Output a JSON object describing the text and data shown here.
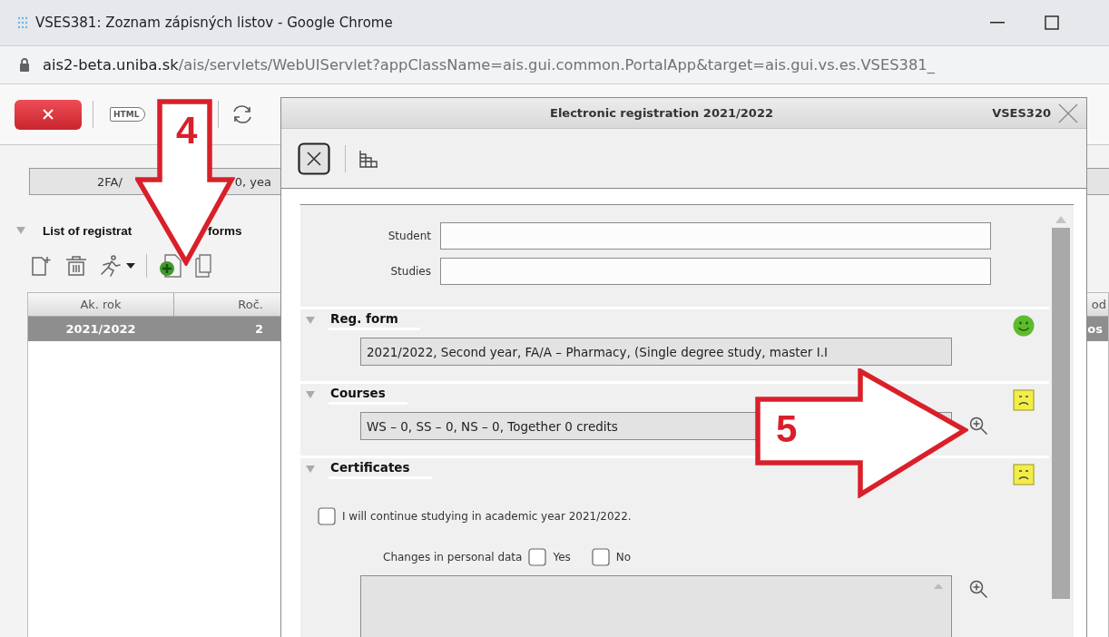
{
  "window": {
    "title": "VSES381: Zoznam zápisných listov - Google Chrome"
  },
  "address_bar": {
    "host": "ais2-beta.uniba.sk",
    "path": "/ais/servlets/WebUIServlet?appClassName=ais.gui.common.PortalApp&target=ais.gui.vs.es.VSES381_"
  },
  "page": {
    "html_button": "HTML",
    "study_field": [
      "2FA/",
      "0, yea"
    ],
    "list_section": {
      "title": [
        "List of registrat",
        "forms"
      ],
      "expanded": true
    },
    "table": {
      "columns": [
        "Ak. rok",
        "Roč.",
        "od"
      ],
      "rows": [
        {
          "cells": [
            "2021/2022",
            "2",
            "os"
          ],
          "selected": true
        }
      ]
    }
  },
  "dialog": {
    "title": "Electronic registration 2021/2022",
    "code": "VSES320",
    "fields": [
      {
        "label": "Student"
      },
      {
        "label": "Studies"
      }
    ],
    "sections": [
      {
        "kind": "field",
        "title": "Reg. form",
        "expanded": true,
        "complete": true,
        "value": "2021/2022, Second year, FA/A – Pharmacy, (Single degree study, master I.I",
        "zoom": false
      },
      {
        "kind": "field",
        "title": "Courses",
        "expanded": true,
        "complete": false,
        "value": "WS – 0, SS – 0, NS – 0, Together 0 credits",
        "zoom": true
      },
      {
        "kind": "certificates",
        "title": "Certificates",
        "expanded": true,
        "complete": false,
        "continue": {
          "label": "I will continue studying in academic year 2021/2022.",
          "checked": false
        },
        "changes": {
          "label": "Changes in personal data",
          "options": [
            {
              "label": "Yes",
              "checked": false
            },
            {
              "label": "No",
              "checked": false
            }
          ]
        },
        "zoom": true
      }
    ]
  },
  "annotations": [
    {
      "kind": "down",
      "label": "4"
    },
    {
      "kind": "right",
      "label": "5"
    }
  ]
}
